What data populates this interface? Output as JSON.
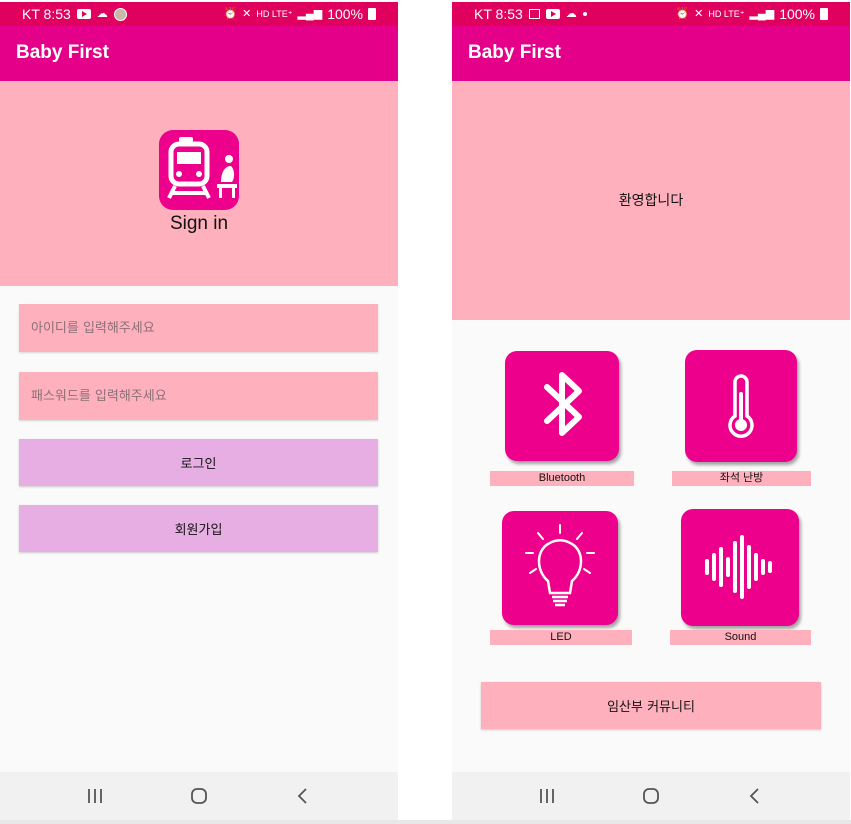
{
  "status_bar": {
    "carrier_time": "KT 8:53",
    "battery": "100%",
    "network": "HD LTE⁺"
  },
  "app": {
    "title": "Baby First"
  },
  "login_screen": {
    "sign_in_label": "Sign in",
    "id_placeholder": "아이디를 입력해주세요",
    "password_placeholder": "패스워드를 입력해주세요",
    "login_button": "로그인",
    "signup_button": "회원가입"
  },
  "main_screen": {
    "welcome": "환영합니다",
    "tiles": [
      {
        "label": "Bluetooth",
        "icon": "bluetooth-icon"
      },
      {
        "label": "좌석 난방",
        "icon": "thermometer-icon"
      },
      {
        "label": "LED",
        "icon": "lightbulb-icon"
      },
      {
        "label": "Sound",
        "icon": "sound-wave-icon"
      }
    ],
    "community_button": "임산부 커뮤니티"
  },
  "colors": {
    "status_bar": "#e0005e",
    "app_bar": "#e5008a",
    "header_pink": "#ffb0bd",
    "tile_magenta": "#ec008c",
    "button_purple": "#e6aee3"
  },
  "nav_bar": {
    "icons": [
      "recents-icon",
      "home-icon",
      "back-icon"
    ]
  }
}
